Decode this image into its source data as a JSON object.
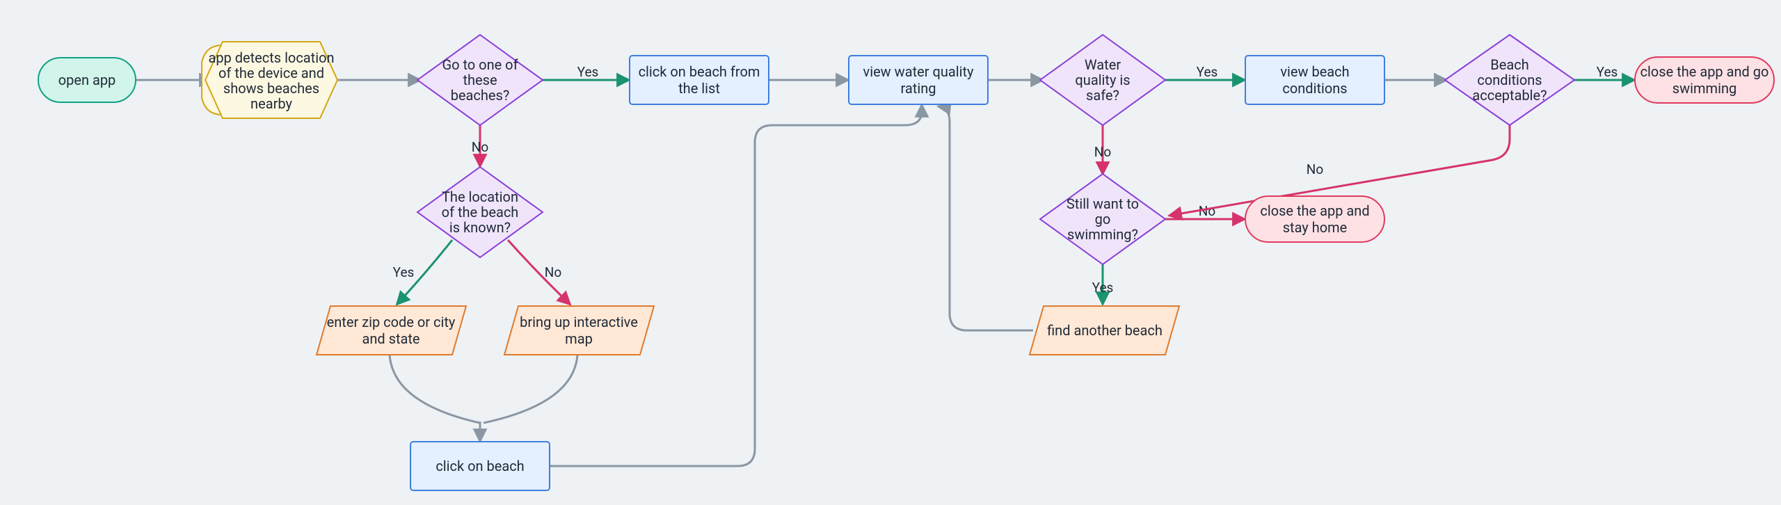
{
  "chart_data": {
    "type": "flowchart",
    "title": "",
    "nodes": [
      {
        "id": "open_app",
        "kind": "terminal",
        "label": "open app"
      },
      {
        "id": "detect",
        "kind": "process",
        "label": "app detects location of the device and shows beaches nearby"
      },
      {
        "id": "go_one",
        "kind": "decision",
        "label": "Go to one of these beaches?"
      },
      {
        "id": "known",
        "kind": "decision",
        "label": "The  location of the beach is known?"
      },
      {
        "id": "enter_zip",
        "kind": "io",
        "label": "enter zip code or city and state"
      },
      {
        "id": "map",
        "kind": "io",
        "label": "bring up interactive map"
      },
      {
        "id": "click_beach",
        "kind": "process",
        "label": "click on beach"
      },
      {
        "id": "click_list",
        "kind": "process",
        "label": "click on beach from the list"
      },
      {
        "id": "view_quality",
        "kind": "process",
        "label": "view water quality rating"
      },
      {
        "id": "quality_safe",
        "kind": "decision",
        "label": "Water quality is safe?"
      },
      {
        "id": "still_swim",
        "kind": "decision",
        "label": "Still want to go swimming?"
      },
      {
        "id": "find_another",
        "kind": "io",
        "label": "find another beach"
      },
      {
        "id": "view_cond",
        "kind": "process",
        "label": "view beach conditions"
      },
      {
        "id": "cond_ok",
        "kind": "decision",
        "label": "Beach conditions acceptable?"
      },
      {
        "id": "go_swim",
        "kind": "terminal",
        "label": "close the app and go swimming"
      },
      {
        "id": "stay_home",
        "kind": "terminal",
        "label": "close the app and stay home"
      }
    ],
    "edges": [
      {
        "from": "open_app",
        "to": "detect",
        "label": ""
      },
      {
        "from": "detect",
        "to": "go_one",
        "label": ""
      },
      {
        "from": "go_one",
        "to": "click_list",
        "label": "Yes"
      },
      {
        "from": "go_one",
        "to": "known",
        "label": "No"
      },
      {
        "from": "known",
        "to": "enter_zip",
        "label": "Yes"
      },
      {
        "from": "known",
        "to": "map",
        "label": "No"
      },
      {
        "from": "enter_zip",
        "to": "click_beach",
        "label": ""
      },
      {
        "from": "map",
        "to": "click_beach",
        "label": ""
      },
      {
        "from": "click_beach",
        "to": "view_quality",
        "label": ""
      },
      {
        "from": "click_list",
        "to": "view_quality",
        "label": ""
      },
      {
        "from": "view_quality",
        "to": "quality_safe",
        "label": ""
      },
      {
        "from": "quality_safe",
        "to": "view_cond",
        "label": "Yes"
      },
      {
        "from": "quality_safe",
        "to": "still_swim",
        "label": "No"
      },
      {
        "from": "still_swim",
        "to": "find_another",
        "label": "Yes"
      },
      {
        "from": "still_swim",
        "to": "stay_home",
        "label": "No"
      },
      {
        "from": "find_another",
        "to": "view_quality",
        "label": ""
      },
      {
        "from": "view_cond",
        "to": "cond_ok",
        "label": ""
      },
      {
        "from": "cond_ok",
        "to": "go_swim",
        "label": "Yes"
      },
      {
        "from": "cond_ok",
        "to": "still_swim",
        "label": "No"
      }
    ]
  },
  "nodes": {
    "open_app": "open app",
    "detect_l1": "app detects location",
    "detect_l2": "of the device and",
    "detect_l3": "shows beaches",
    "detect_l4": "nearby",
    "go_one_l1": "Go to one of",
    "go_one_l2": "these",
    "go_one_l3": "beaches?",
    "known_l1": "The  location",
    "known_l2": "of the beach",
    "known_l3": "is known?",
    "enter_zip_l1": "enter zip code or city",
    "enter_zip_l2": "and state",
    "map_l1": "bring up interactive",
    "map_l2": "map",
    "click_beach": "click on beach",
    "click_list_l1": "click on beach from",
    "click_list_l2": "the list",
    "view_quality_l1": "view water quality",
    "view_quality_l2": "rating",
    "quality_safe_l1": "Water",
    "quality_safe_l2": "quality is",
    "quality_safe_l3": "safe?",
    "still_swim_l1": "Still want to",
    "still_swim_l2": "go",
    "still_swim_l3": "swimming?",
    "find_another": "find another beach",
    "view_cond_l1": "view beach",
    "view_cond_l2": "conditions",
    "cond_ok_l1": "Beach",
    "cond_ok_l2": "conditions",
    "cond_ok_l3": "acceptable?",
    "go_swim_l1": "close the app and go",
    "go_swim_l2": "swimming",
    "stay_home_l1": "close the app and",
    "stay_home_l2": "stay home"
  },
  "labels": {
    "yes": "Yes",
    "no": "No"
  }
}
